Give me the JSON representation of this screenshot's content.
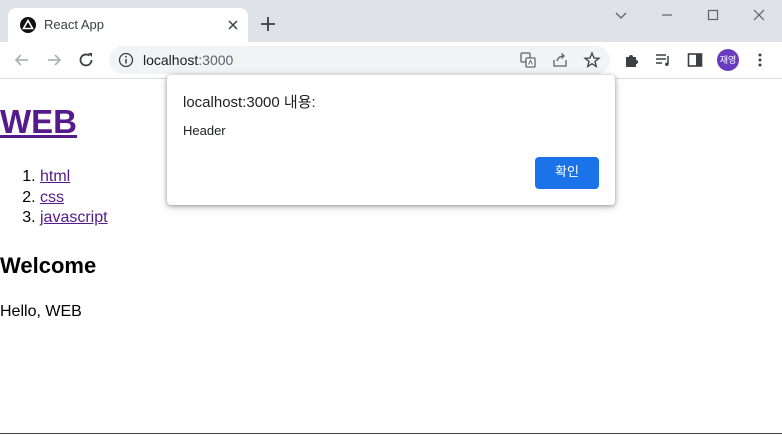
{
  "browser": {
    "tab": {
      "title": "React App",
      "favicon": "react-app-icon"
    },
    "url": {
      "host": "localhost",
      "port": ":3000"
    },
    "profile_initials": "재영",
    "colors": {
      "tabstrip": "#dee1e6",
      "avatar": "#6a3bbf"
    }
  },
  "page": {
    "title_link": "WEB",
    "topics": [
      "html",
      "css",
      "javascript"
    ],
    "article_title": "Welcome",
    "article_body": "Hello, WEB",
    "link_color": "#551a8b"
  },
  "alert_dialog": {
    "origin_text": "localhost:3000 내용:",
    "message": "Header",
    "ok_label": "확인",
    "button_color": "#1a73e8"
  }
}
